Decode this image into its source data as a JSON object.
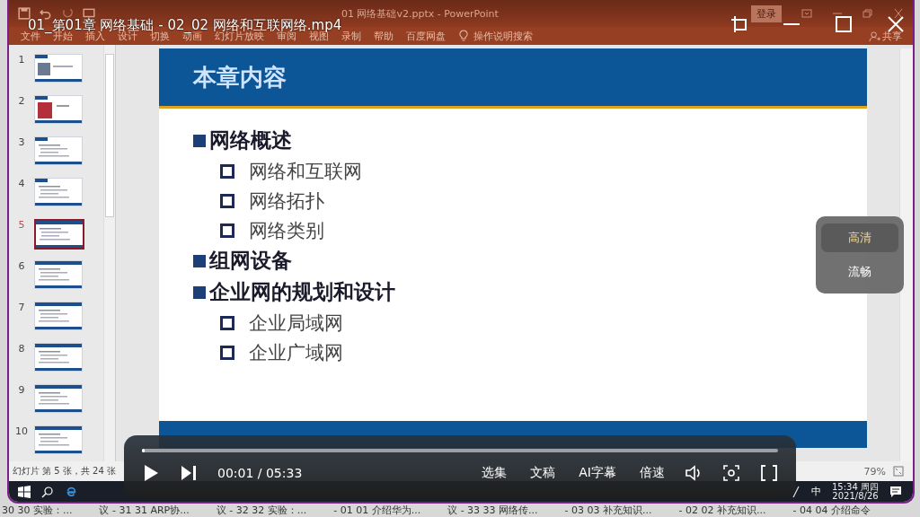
{
  "video": {
    "title": "01_第01章 网络基础 - 02_02 网络和互联网络.mp4"
  },
  "ppt": {
    "title": "01 网络基础v2.pptx - PowerPoint",
    "sign_in": "登录",
    "tabs": [
      "文件",
      "开始",
      "插入",
      "设计",
      "切换",
      "动画",
      "幻灯片放映",
      "审阅",
      "视图",
      "录制",
      "帮助",
      "百度网盘"
    ],
    "tell_me": "操作说明搜索",
    "share": "共享"
  },
  "thumbnails": [
    {
      "number": "1",
      "selected": false
    },
    {
      "number": "2",
      "selected": false
    },
    {
      "number": "3",
      "selected": false
    },
    {
      "number": "4",
      "selected": false
    },
    {
      "number": "5",
      "selected": true
    },
    {
      "number": "6",
      "selected": false
    },
    {
      "number": "7",
      "selected": false
    },
    {
      "number": "8",
      "selected": false
    },
    {
      "number": "9",
      "selected": false
    },
    {
      "number": "10",
      "selected": false
    }
  ],
  "slide": {
    "title": "本章内容",
    "items": [
      {
        "text": "网络概述",
        "children": [
          {
            "text": "网络和互联网"
          },
          {
            "text": "网络拓扑"
          },
          {
            "text": "网络类别"
          }
        ]
      },
      {
        "text": "组网设备"
      },
      {
        "text": "企业网的规划和设计",
        "children": [
          {
            "text": "企业局域网"
          },
          {
            "text": "企业广域网"
          }
        ]
      }
    ]
  },
  "status_bar": {
    "slide_info": "幻灯片 第 5 张，共 24 张",
    "zoom": "79%"
  },
  "taskbar": {
    "ime": "中",
    "time": "15:34 周四",
    "date": "2021/8/26"
  },
  "quality_menu": [
    {
      "label": "高清",
      "selected": true
    },
    {
      "label": "流畅",
      "selected": false
    }
  ],
  "player": {
    "progress": {
      "level": 0.003
    },
    "time": "00:01 / 05:33",
    "buttons": [
      "选集",
      "文稿",
      "AI字幕",
      "倍速"
    ]
  },
  "background_tabs": [
    "30 30 实验：...",
    "议 - 31 31 ARP协...",
    "议 - 32 32 实验：...",
    "- 01 01 介绍华为...",
    "议 - 33 33 网络传...",
    "- 03 03 补充知识...",
    "- 02 02 补充知识...",
    "- 04 04 介绍命令"
  ]
}
